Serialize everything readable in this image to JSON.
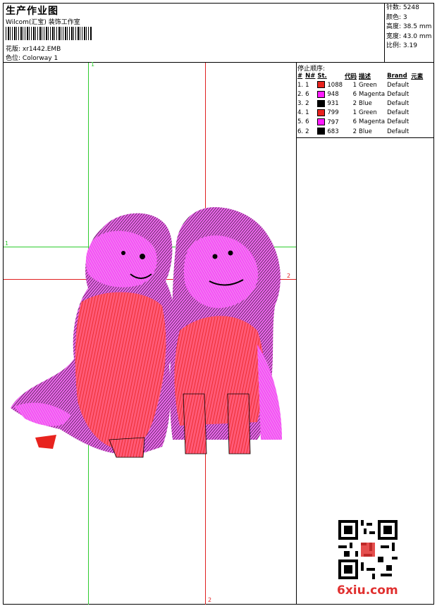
{
  "header": {
    "title": "生产作业图",
    "company": "Wilcom(汇宝) 装饰工作室",
    "design_label": "花版:",
    "design_value": "xr1442.EMB",
    "colorway_label": "色位:",
    "colorway_value": "Colorway 1"
  },
  "stats": [
    {
      "label": "针数:",
      "value": "5248"
    },
    {
      "label": "颜色:",
      "value": "3"
    },
    {
      "label": "高度:",
      "value": "38.5 mm"
    },
    {
      "label": "宽度:",
      "value": "43.0 mm"
    },
    {
      "label": "比例:",
      "value": "3.19"
    }
  ],
  "guides": {
    "green_label": "1",
    "red_label": "2"
  },
  "stop_sequence": {
    "title": "停止顺序:",
    "headers": [
      "#",
      "N#",
      "St.",
      "代码",
      "描述",
      "Brand",
      "元素"
    ],
    "rows": [
      {
        "idx": "1.",
        "n": "1",
        "st": "1088",
        "code": "1",
        "desc": "Green",
        "brand": "Default",
        "color": "#e8231e"
      },
      {
        "idx": "2.",
        "n": "6",
        "st": "948",
        "code": "6",
        "desc": "Magenta",
        "brand": "Default",
        "color": "#ff1aff"
      },
      {
        "idx": "3.",
        "n": "2",
        "st": "931",
        "code": "2",
        "desc": "Blue",
        "brand": "Default",
        "color": "#000000"
      },
      {
        "idx": "4.",
        "n": "1",
        "st": "799",
        "code": "1",
        "desc": "Green",
        "brand": "Default",
        "color": "#e8231e"
      },
      {
        "idx": "5.",
        "n": "6",
        "st": "797",
        "code": "6",
        "desc": "Magenta",
        "brand": "Default",
        "color": "#ff1aff"
      },
      {
        "idx": "6.",
        "n": "2",
        "st": "683",
        "code": "2",
        "desc": "Blue",
        "brand": "Default",
        "color": "#000000"
      }
    ]
  },
  "watermark": {
    "site": "6xiu.com"
  },
  "colors": {
    "red": "#e8231e",
    "magenta": "#ff1aff",
    "black": "#000000",
    "guide_green": "#2ecc2e",
    "guide_red": "#e02020"
  }
}
